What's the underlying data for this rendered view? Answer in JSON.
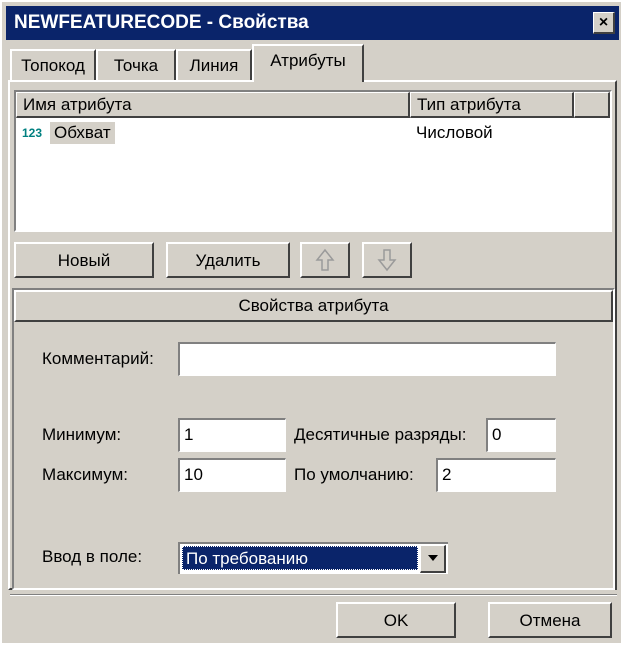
{
  "window": {
    "title": "NEWFEATURECODE - Свойства",
    "close": "×"
  },
  "tabs": [
    {
      "label": "Топокод"
    },
    {
      "label": "Точка"
    },
    {
      "label": "Линия"
    },
    {
      "label": "Атрибуты",
      "active": true
    }
  ],
  "attr_list": {
    "columns": [
      "Имя атрибута",
      "Тип атрибута"
    ],
    "rows": [
      {
        "icon": "numeric-attribute-icon",
        "icon_text": "123",
        "name": "Обхват",
        "type": "Числовой"
      }
    ]
  },
  "list_buttons": {
    "new": "Новый",
    "delete": "Удалить",
    "up_icon": "up-arrow-icon",
    "down_icon": "down-arrow-icon"
  },
  "properties": {
    "header": "Свойства атрибута",
    "comment_label": "Комментарий:",
    "comment_value": "",
    "min_label": "Минимум:",
    "min_value": "1",
    "max_label": "Максимум:",
    "max_value": "10",
    "decimals_label": "Десятичные разряды:",
    "decimals_value": "0",
    "default_label": "По умолчанию:",
    "default_value": "2",
    "input_label": "Ввод в поле:",
    "input_value": "По требованию"
  },
  "footer": {
    "ok": "OK",
    "cancel": "Отмена"
  },
  "colors": {
    "face": "#d4d0c8",
    "titlebar": "#0a246a",
    "selection": "#0a246a",
    "icon": "#008080"
  }
}
